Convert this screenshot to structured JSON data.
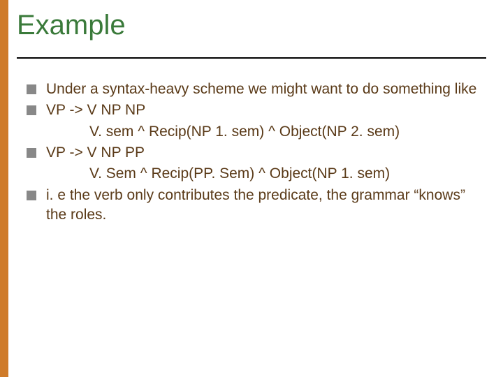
{
  "title": "Example",
  "bullets": [
    {
      "text": "Under a syntax-heavy scheme we might want to do something like"
    },
    {
      "text": "VP -> V NP NP",
      "sub": "V. sem ^ Recip(NP 1. sem) ^ Object(NP 2. sem)"
    },
    {
      "text": "VP -> V NP PP",
      "sub": "V. Sem ^ Recip(PP. Sem) ^ Object(NP 1. sem)"
    },
    {
      "text": "i. e the verb only contributes the predicate, the grammar “knows” the roles."
    }
  ]
}
